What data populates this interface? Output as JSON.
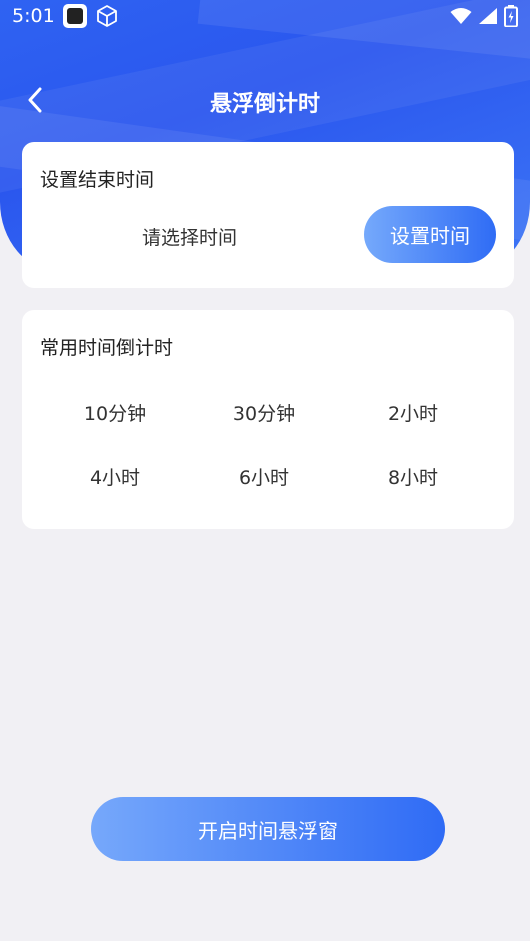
{
  "status_bar": {
    "time": "5:01",
    "icons": [
      "app-notification-icon",
      "cube-icon",
      "wifi-icon",
      "signal-icon",
      "battery-icon"
    ]
  },
  "nav": {
    "title": "悬浮倒计时",
    "back_icon": "chevron-left-icon"
  },
  "end_time_card": {
    "title": "设置结束时间",
    "placeholder": "请选择时间",
    "button_label": "设置时间"
  },
  "presets_card": {
    "title": "常用时间倒计时",
    "options": [
      "10分钟",
      "30分钟",
      "2小时",
      "4小时",
      "6小时",
      "8小时"
    ]
  },
  "start_button_label": "开启时间悬浮窗",
  "colors": {
    "header_blue": "#2f63f2",
    "button_gradient_start": "#75a9fb",
    "button_gradient_end": "#2f6cf5",
    "page_background": "#f1f0f4"
  }
}
